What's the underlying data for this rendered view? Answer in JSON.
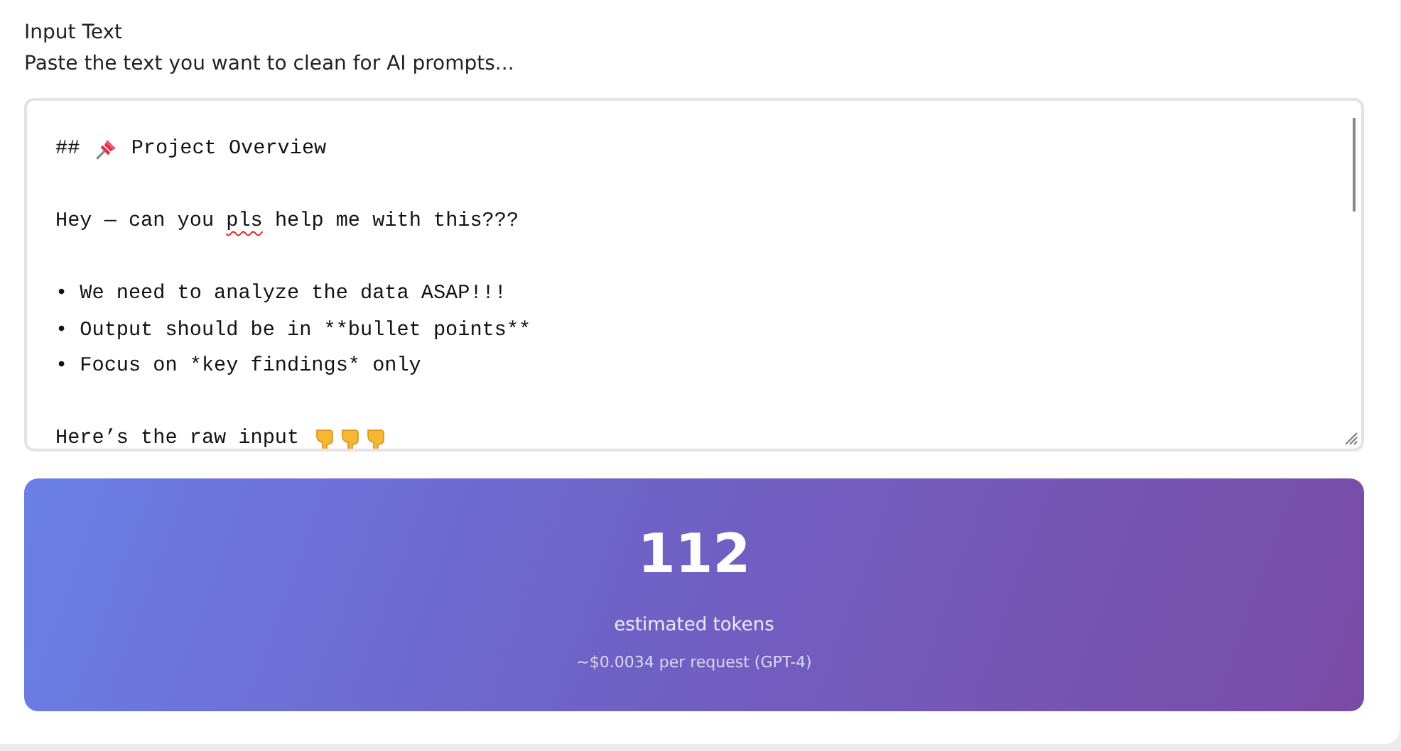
{
  "input": {
    "label": "Input Text",
    "hint": "Paste the text you want to clean for AI prompts...",
    "lines": [
      {
        "parts": [
          {
            "kind": "text",
            "text": "## "
          },
          {
            "kind": "pin"
          },
          {
            "kind": "text",
            "text": " Project Overview"
          }
        ]
      },
      {
        "kind": "blank"
      },
      {
        "parts": [
          {
            "kind": "text",
            "text": "Hey — can you "
          },
          {
            "kind": "misspelled",
            "text": "pls"
          },
          {
            "kind": "text",
            "text": " help me with this???"
          }
        ]
      },
      {
        "kind": "blank"
      },
      {
        "parts": [
          {
            "kind": "text",
            "text": "• We need to analyze the data ASAP!!!"
          }
        ]
      },
      {
        "parts": [
          {
            "kind": "text",
            "text": "• Output should be in **bullet points**"
          }
        ]
      },
      {
        "parts": [
          {
            "kind": "text",
            "text": "• Focus on *key findings* only"
          }
        ]
      },
      {
        "kind": "blank"
      },
      {
        "parts": [
          {
            "kind": "text",
            "text": "Here’s the raw input "
          },
          {
            "kind": "hand"
          },
          {
            "kind": "hand"
          },
          {
            "kind": "hand"
          }
        ]
      }
    ]
  },
  "stats": {
    "count": "112",
    "label": "estimated tokens",
    "cost": "~$0.0034 per request (GPT-4)"
  }
}
